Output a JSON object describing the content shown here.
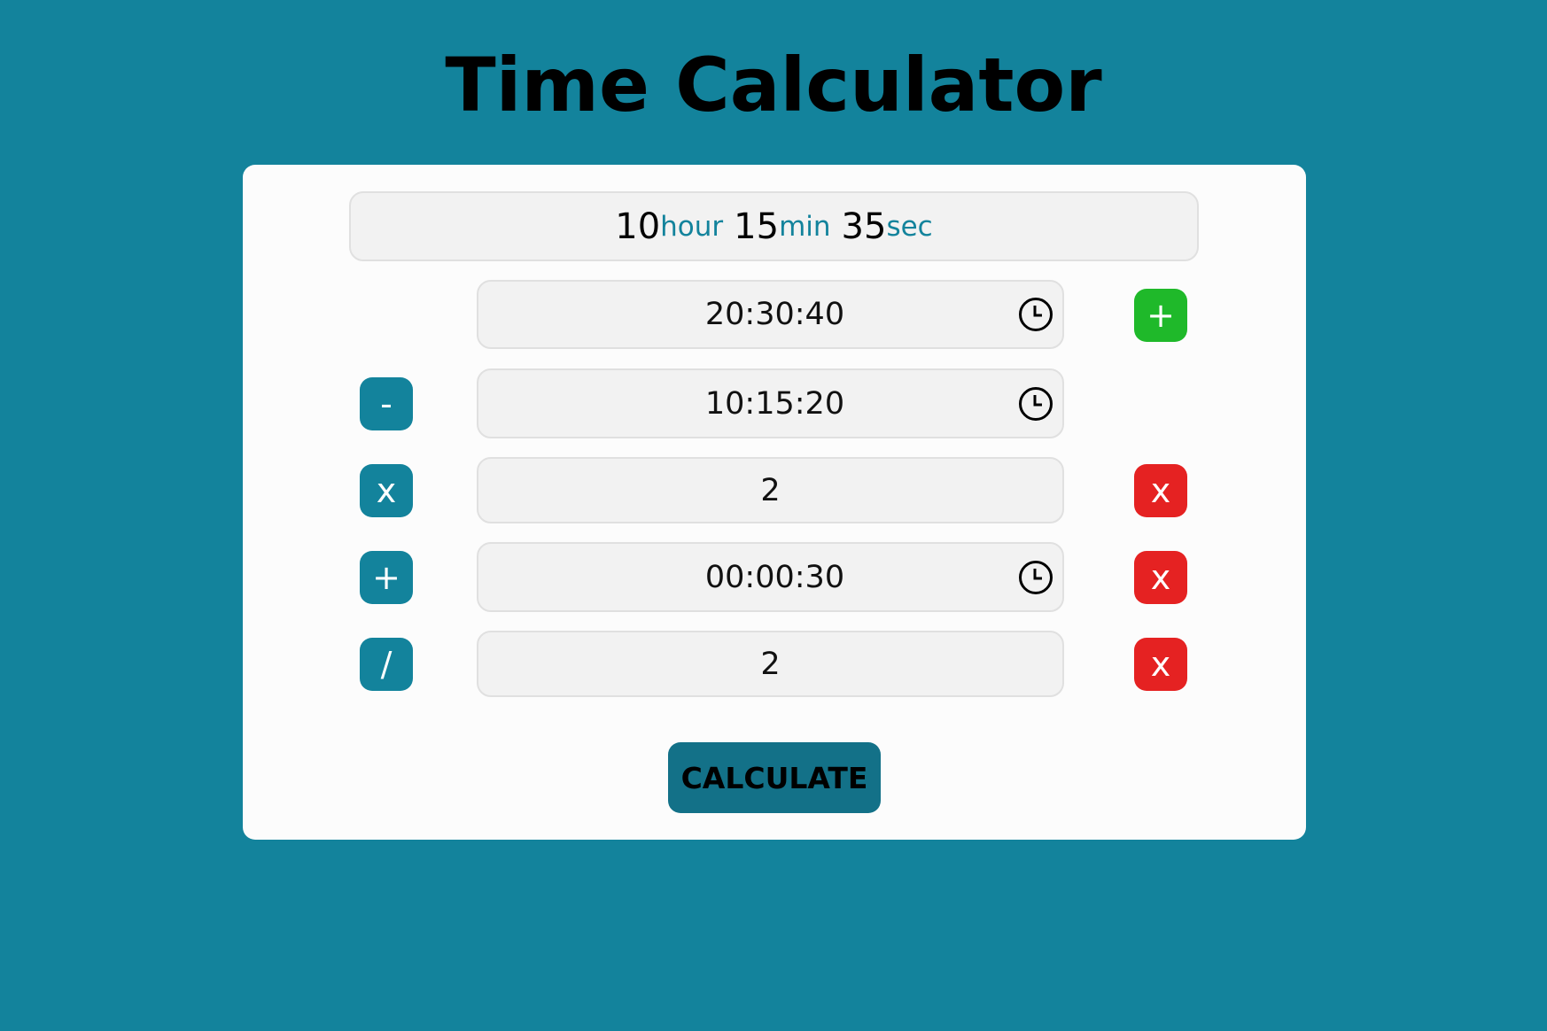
{
  "header": {
    "title": "Time Calculator"
  },
  "result": {
    "hours": "10",
    "hours_unit": "hour",
    "minutes": "15",
    "minutes_unit": "min",
    "seconds": "35",
    "seconds_unit": "sec"
  },
  "rows": [
    {
      "operator": "",
      "value": "20:30:40",
      "type": "time",
      "action": "add",
      "action_label": "+"
    },
    {
      "operator": "-",
      "value": "10:15:20",
      "type": "time",
      "action": "",
      "action_label": ""
    },
    {
      "operator": "x",
      "value": "2",
      "type": "number",
      "action": "remove",
      "action_label": "x"
    },
    {
      "operator": "+",
      "value": "00:00:30",
      "type": "time",
      "action": "remove",
      "action_label": "x"
    },
    {
      "operator": "/",
      "value": "2",
      "type": "number",
      "action": "remove",
      "action_label": "x"
    }
  ],
  "icons": {
    "clock": "clock-icon",
    "add": "plus-icon",
    "remove": "close-icon"
  },
  "calculate_label": "CALCULATE",
  "colors": {
    "background": "#13839c",
    "operator_button": "#13839c",
    "add_button": "#1fb92a",
    "remove_button": "#e52222",
    "calculate_button": "#137188",
    "unit_text": "#13839c"
  }
}
